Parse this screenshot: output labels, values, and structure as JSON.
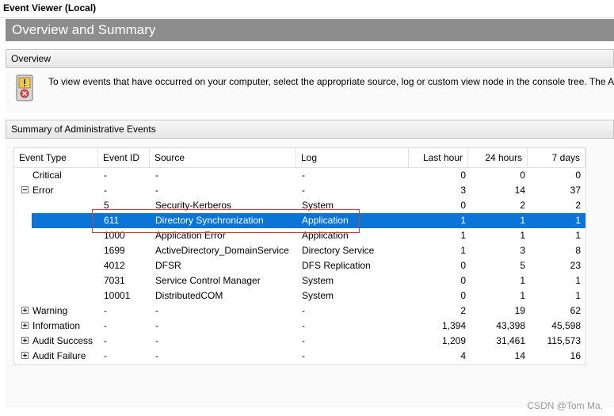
{
  "window": {
    "title": "Event Viewer (Local)"
  },
  "banner": {
    "title": "Overview and Summary"
  },
  "overview": {
    "header": "Overview",
    "icon": "event-viewer-icon",
    "text": "To view events that have occurred on your computer, select the appropriate source, log or custom view node in the console tree. The Ac"
  },
  "summary": {
    "header": "Summary of Administrative Events",
    "columns": [
      "Event Type",
      "Event ID",
      "Source",
      "Log",
      "Last hour",
      "24 hours",
      "7 days"
    ],
    "rows": [
      {
        "type": "Critical",
        "id": "-",
        "source": "-",
        "log": "-",
        "h1": "0",
        "h24": "0",
        "d7": "0"
      },
      {
        "type": "Error",
        "id": "-",
        "source": "-",
        "log": "-",
        "h1": "3",
        "h24": "14",
        "d7": "37"
      },
      {
        "type": "",
        "id": "5",
        "source": "Security-Kerberos",
        "log": "System",
        "h1": "0",
        "h24": "2",
        "d7": "2"
      },
      {
        "type": "",
        "id": "611",
        "source": "Directory Synchronization",
        "log": "Application",
        "h1": "1",
        "h24": "1",
        "d7": "1"
      },
      {
        "type": "",
        "id": "1000",
        "source": "Application Error",
        "log": "Application",
        "h1": "1",
        "h24": "1",
        "d7": "1"
      },
      {
        "type": "",
        "id": "1699",
        "source": "ActiveDirectory_DomainService",
        "log": "Directory Service",
        "h1": "1",
        "h24": "3",
        "d7": "8"
      },
      {
        "type": "",
        "id": "4012",
        "source": "DFSR",
        "log": "DFS Replication",
        "h1": "0",
        "h24": "5",
        "d7": "23"
      },
      {
        "type": "",
        "id": "7031",
        "source": "Service Control Manager",
        "log": "System",
        "h1": "0",
        "h24": "1",
        "d7": "1"
      },
      {
        "type": "",
        "id": "10001",
        "source": "DistributedCOM",
        "log": "System",
        "h1": "0",
        "h24": "1",
        "d7": "1"
      },
      {
        "type": "Warning",
        "id": "-",
        "source": "-",
        "log": "-",
        "h1": "2",
        "h24": "19",
        "d7": "62"
      },
      {
        "type": "Information",
        "id": "-",
        "source": "-",
        "log": "-",
        "h1": "1,394",
        "h24": "43,398",
        "d7": "45,598"
      },
      {
        "type": "Audit Success",
        "id": "-",
        "source": "-",
        "log": "-",
        "h1": "1,209",
        "h24": "31,461",
        "d7": "115,573"
      },
      {
        "type": "Audit Failure",
        "id": "-",
        "source": "-",
        "log": "-",
        "h1": "4",
        "h24": "14",
        "d7": "16"
      }
    ]
  },
  "watermark": "CSDN @Tom Ma.",
  "colors": {
    "selection": "#0a74d8",
    "banner": "#8d8d8d",
    "highlight_box": "#d33a3a"
  }
}
